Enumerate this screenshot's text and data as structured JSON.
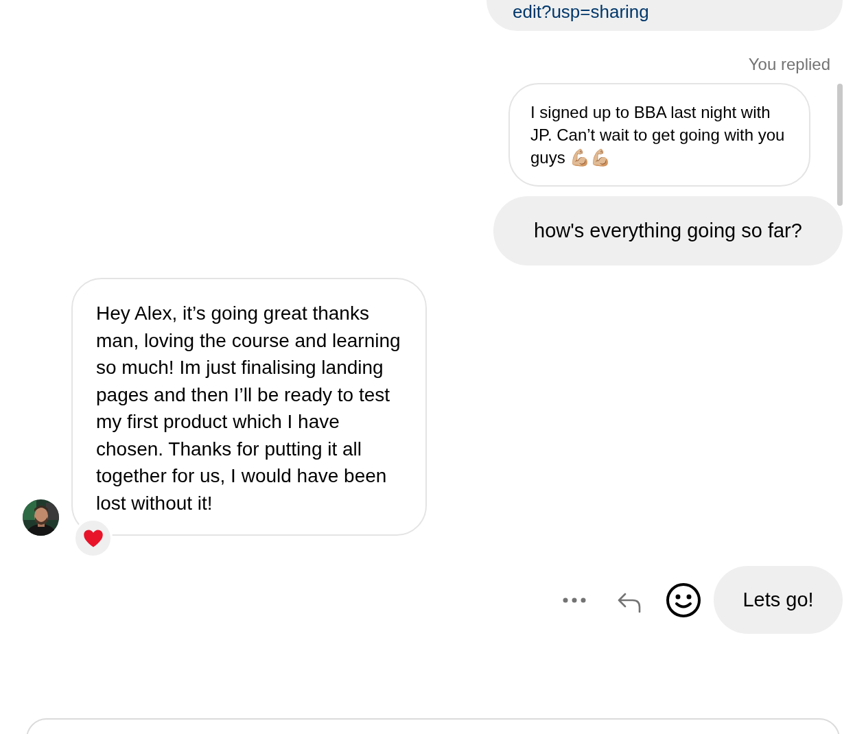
{
  "link_message": {
    "text": "edit?usp=sharing"
  },
  "reply": {
    "label": "You replied",
    "quoted_text": "I signed up to BBA last night with JP. Can’t wait to get going with you guys 💪🏼💪🏼",
    "text": "how's everything going so far?"
  },
  "received": {
    "text": "Hey Alex, it’s going great thanks man, loving the course and learning so much! Im just finalising landing pages and then I’ll be ready to test my first product which I have chosen. Thanks for putting it all together for us, I would have been lost without it!"
  },
  "last_message": {
    "text": "Lets go!"
  }
}
